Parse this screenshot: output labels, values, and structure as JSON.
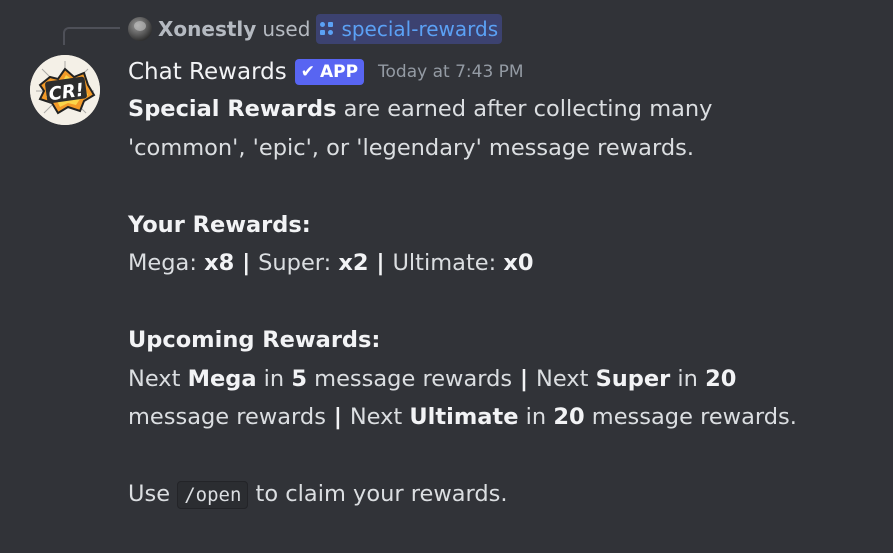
{
  "reply": {
    "username": "Xonestly",
    "used_text": "used",
    "command": "special-rewards"
  },
  "bot": {
    "username": "Chat Rewards",
    "badge": "APP",
    "timestamp": "Today at 7:43 PM",
    "avatar_text": "CR!"
  },
  "content": {
    "intro_bold": "Special Rewards",
    "intro_rest_line1": " are earned after collecting many",
    "intro_line2": "'common', 'epic', or 'legendary' message rewards.",
    "your_rewards_heading": "Your Rewards:",
    "mega_label": "Mega: ",
    "mega_value": "x8",
    "sep": " | ",
    "super_label": "Super: ",
    "super_value": "x2",
    "ultimate_label": "Ultimate: ",
    "ultimate_value": "x0",
    "upcoming_heading": "Upcoming Rewards:",
    "next_word": "Next ",
    "mega_word": "Mega",
    "in_word": " in ",
    "mega_count": "5",
    "msg_rewards": " message rewards",
    "super_word": "Super",
    "super_count": "20",
    "line2_start": "message rewards",
    "ultimate_word": "Ultimate",
    "ultimate_count": "20",
    "final_msg_rewards": " message rewards.",
    "use_word": "Use ",
    "open_command": "/open",
    "claim_text": " to claim your rewards."
  },
  "colors": {
    "background": "#313338",
    "brand": "#5865f2",
    "command_pill": "#3c4270",
    "link_blue": "#5ba1f5"
  }
}
